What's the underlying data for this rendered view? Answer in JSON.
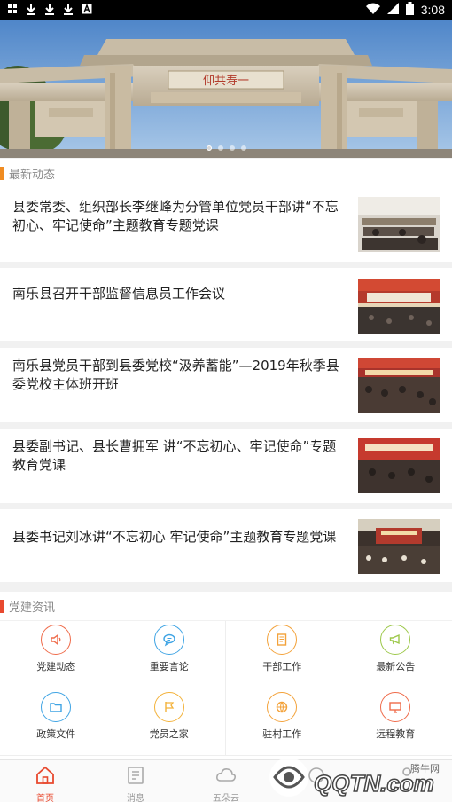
{
  "status_bar": {
    "time": "3:08",
    "left_icons": [
      "app-icon",
      "download-icon",
      "download-icon",
      "download-icon",
      "font-icon"
    ],
    "right_icons": [
      "wifi-icon",
      "signal-icon",
      "battery-icon"
    ]
  },
  "banner": {
    "plaque_text": "仰共寿一",
    "slide_count": 4,
    "active_slide": 1
  },
  "news_section": {
    "title": "最新动态",
    "accent_color": "#f08c22",
    "items": [
      {
        "title": "县委常委、组织部长李继峰为分管单位党员干部讲“不忘初心、牢记使命”主题教育专题党课"
      },
      {
        "title": "南乐县召开干部监督信息员工作会议"
      },
      {
        "title": "南乐县党员干部到县委党校“汲养蓄能”—2019年秋季县委党校主体班开班"
      },
      {
        "title": "县委副书记、县长曹拥军 讲“不忘初心、牢记使命”专题教育党课"
      },
      {
        "title": "县委书记刘冰讲“不忘初心 牢记使命”主题教育专题党课"
      }
    ]
  },
  "party_section": {
    "title": "党建资讯",
    "accent_color": "#e8492f",
    "items": [
      {
        "label": "党建动态",
        "icon": "speaker-icon",
        "color": "#ef6b4a"
      },
      {
        "label": "重要言论",
        "icon": "chat-bubble-icon",
        "color": "#3fa4e4"
      },
      {
        "label": "干部工作",
        "icon": "document-icon",
        "color": "#f3a23a"
      },
      {
        "label": "最新公告",
        "icon": "megaphone-icon",
        "color": "#9dc84a"
      },
      {
        "label": "政策文件",
        "icon": "folder-icon",
        "color": "#3fa4e4"
      },
      {
        "label": "党员之家",
        "icon": "flag-icon",
        "color": "#f3b23a"
      },
      {
        "label": "驻村工作",
        "icon": "globe-icon",
        "color": "#f3a23a"
      },
      {
        "label": "远程教育",
        "icon": "monitor-icon",
        "color": "#ef6b4a"
      }
    ]
  },
  "bottom_nav": {
    "active_color": "#e8492f",
    "items": [
      {
        "label": "首页",
        "icon": "home-icon"
      },
      {
        "label": "消息",
        "icon": "message-icon"
      },
      {
        "label": "五朵云",
        "icon": "cloud-icon"
      },
      {
        "label": "",
        "icon": "compass-icon"
      },
      {
        "label": "",
        "icon": "user-icon"
      }
    ]
  },
  "watermark": {
    "site_name": "腾牛网",
    "brand": "QQTN.com"
  }
}
